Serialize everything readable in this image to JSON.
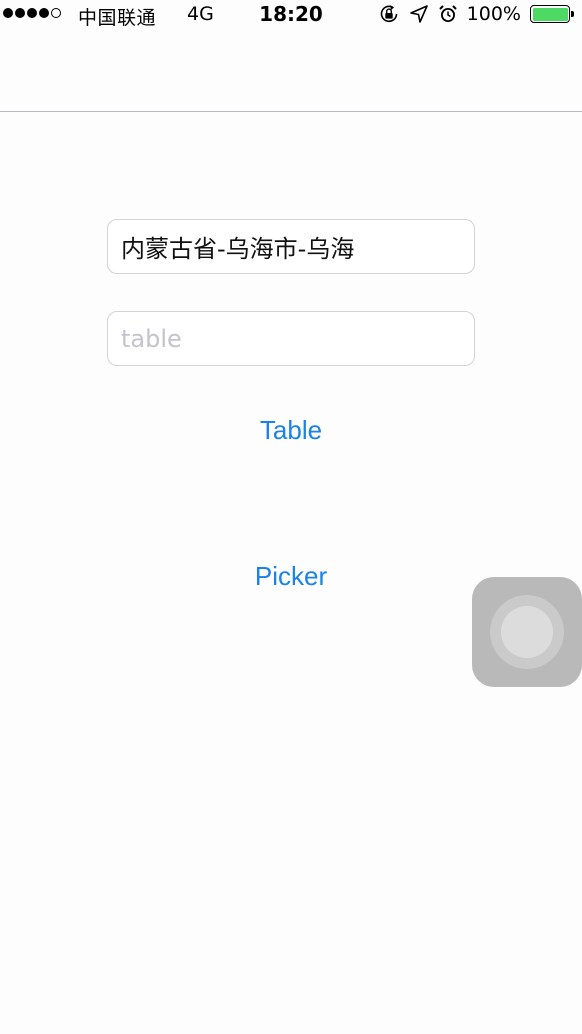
{
  "status_bar": {
    "carrier": "中国联通",
    "network": "4G",
    "time": "18:20",
    "battery_percent": "100%",
    "signal_bars_filled": 4,
    "signal_bars_total": 5,
    "battery_color": "#4cd964",
    "icons": [
      "rotation-lock-icon",
      "location-arrow-icon",
      "alarm-icon",
      "battery-icon"
    ]
  },
  "form": {
    "location_field": {
      "value": "内蒙古省-乌海市-乌海",
      "placeholder": ""
    },
    "table_field": {
      "value": "",
      "placeholder": "table"
    }
  },
  "buttons": {
    "table_label": "Table",
    "picker_label": "Picker"
  },
  "colors": {
    "accent": "#1a82e8",
    "background": "#fdfdfd",
    "separator": "#b6b7c4"
  }
}
